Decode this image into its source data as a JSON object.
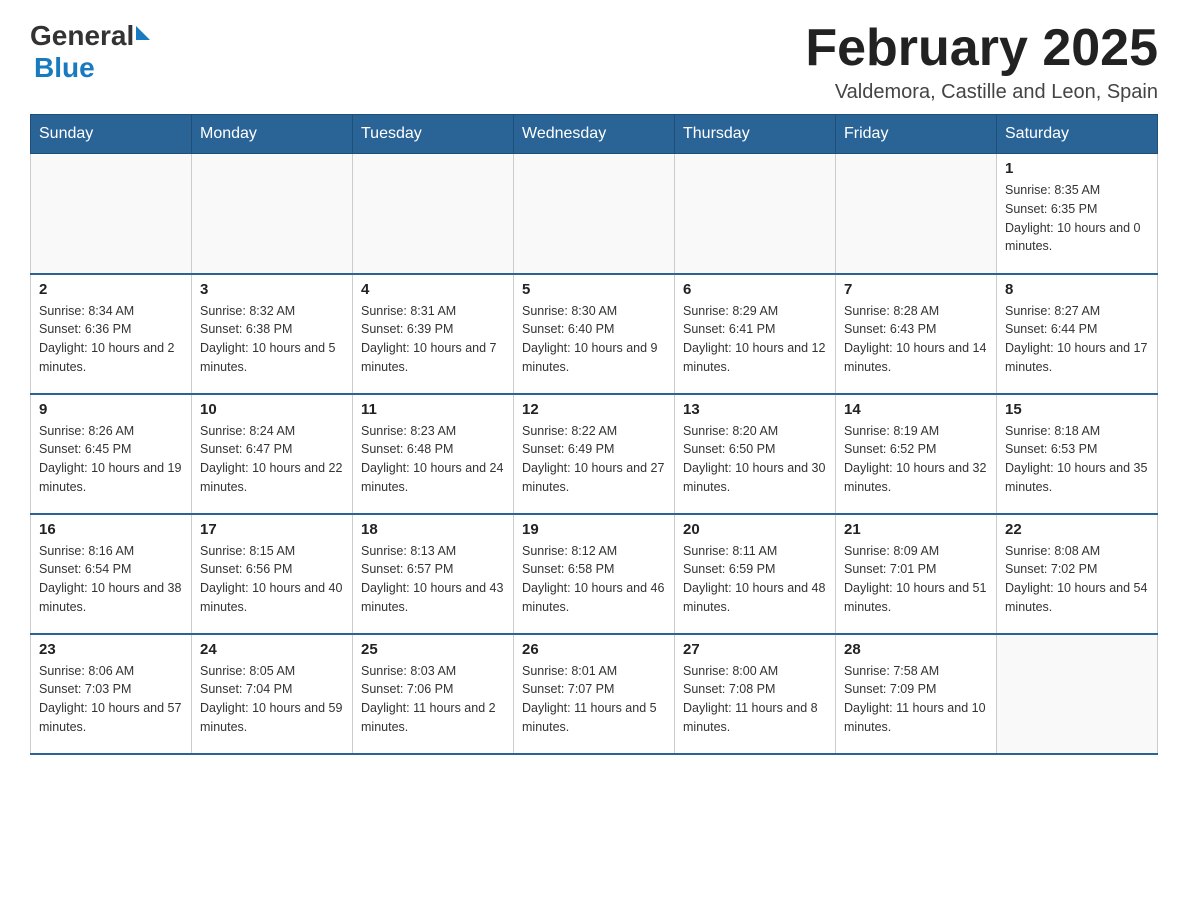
{
  "header": {
    "logo": {
      "general": "General",
      "blue": "Blue"
    },
    "title": "February 2025",
    "location": "Valdemora, Castille and Leon, Spain"
  },
  "weekdays": [
    "Sunday",
    "Monday",
    "Tuesday",
    "Wednesday",
    "Thursday",
    "Friday",
    "Saturday"
  ],
  "weeks": [
    [
      {
        "day": "",
        "info": ""
      },
      {
        "day": "",
        "info": ""
      },
      {
        "day": "",
        "info": ""
      },
      {
        "day": "",
        "info": ""
      },
      {
        "day": "",
        "info": ""
      },
      {
        "day": "",
        "info": ""
      },
      {
        "day": "1",
        "info": "Sunrise: 8:35 AM\nSunset: 6:35 PM\nDaylight: 10 hours and 0 minutes."
      }
    ],
    [
      {
        "day": "2",
        "info": "Sunrise: 8:34 AM\nSunset: 6:36 PM\nDaylight: 10 hours and 2 minutes."
      },
      {
        "day": "3",
        "info": "Sunrise: 8:32 AM\nSunset: 6:38 PM\nDaylight: 10 hours and 5 minutes."
      },
      {
        "day": "4",
        "info": "Sunrise: 8:31 AM\nSunset: 6:39 PM\nDaylight: 10 hours and 7 minutes."
      },
      {
        "day": "5",
        "info": "Sunrise: 8:30 AM\nSunset: 6:40 PM\nDaylight: 10 hours and 9 minutes."
      },
      {
        "day": "6",
        "info": "Sunrise: 8:29 AM\nSunset: 6:41 PM\nDaylight: 10 hours and 12 minutes."
      },
      {
        "day": "7",
        "info": "Sunrise: 8:28 AM\nSunset: 6:43 PM\nDaylight: 10 hours and 14 minutes."
      },
      {
        "day": "8",
        "info": "Sunrise: 8:27 AM\nSunset: 6:44 PM\nDaylight: 10 hours and 17 minutes."
      }
    ],
    [
      {
        "day": "9",
        "info": "Sunrise: 8:26 AM\nSunset: 6:45 PM\nDaylight: 10 hours and 19 minutes."
      },
      {
        "day": "10",
        "info": "Sunrise: 8:24 AM\nSunset: 6:47 PM\nDaylight: 10 hours and 22 minutes."
      },
      {
        "day": "11",
        "info": "Sunrise: 8:23 AM\nSunset: 6:48 PM\nDaylight: 10 hours and 24 minutes."
      },
      {
        "day": "12",
        "info": "Sunrise: 8:22 AM\nSunset: 6:49 PM\nDaylight: 10 hours and 27 minutes."
      },
      {
        "day": "13",
        "info": "Sunrise: 8:20 AM\nSunset: 6:50 PM\nDaylight: 10 hours and 30 minutes."
      },
      {
        "day": "14",
        "info": "Sunrise: 8:19 AM\nSunset: 6:52 PM\nDaylight: 10 hours and 32 minutes."
      },
      {
        "day": "15",
        "info": "Sunrise: 8:18 AM\nSunset: 6:53 PM\nDaylight: 10 hours and 35 minutes."
      }
    ],
    [
      {
        "day": "16",
        "info": "Sunrise: 8:16 AM\nSunset: 6:54 PM\nDaylight: 10 hours and 38 minutes."
      },
      {
        "day": "17",
        "info": "Sunrise: 8:15 AM\nSunset: 6:56 PM\nDaylight: 10 hours and 40 minutes."
      },
      {
        "day": "18",
        "info": "Sunrise: 8:13 AM\nSunset: 6:57 PM\nDaylight: 10 hours and 43 minutes."
      },
      {
        "day": "19",
        "info": "Sunrise: 8:12 AM\nSunset: 6:58 PM\nDaylight: 10 hours and 46 minutes."
      },
      {
        "day": "20",
        "info": "Sunrise: 8:11 AM\nSunset: 6:59 PM\nDaylight: 10 hours and 48 minutes."
      },
      {
        "day": "21",
        "info": "Sunrise: 8:09 AM\nSunset: 7:01 PM\nDaylight: 10 hours and 51 minutes."
      },
      {
        "day": "22",
        "info": "Sunrise: 8:08 AM\nSunset: 7:02 PM\nDaylight: 10 hours and 54 minutes."
      }
    ],
    [
      {
        "day": "23",
        "info": "Sunrise: 8:06 AM\nSunset: 7:03 PM\nDaylight: 10 hours and 57 minutes."
      },
      {
        "day": "24",
        "info": "Sunrise: 8:05 AM\nSunset: 7:04 PM\nDaylight: 10 hours and 59 minutes."
      },
      {
        "day": "25",
        "info": "Sunrise: 8:03 AM\nSunset: 7:06 PM\nDaylight: 11 hours and 2 minutes."
      },
      {
        "day": "26",
        "info": "Sunrise: 8:01 AM\nSunset: 7:07 PM\nDaylight: 11 hours and 5 minutes."
      },
      {
        "day": "27",
        "info": "Sunrise: 8:00 AM\nSunset: 7:08 PM\nDaylight: 11 hours and 8 minutes."
      },
      {
        "day": "28",
        "info": "Sunrise: 7:58 AM\nSunset: 7:09 PM\nDaylight: 11 hours and 10 minutes."
      },
      {
        "day": "",
        "info": ""
      }
    ]
  ]
}
